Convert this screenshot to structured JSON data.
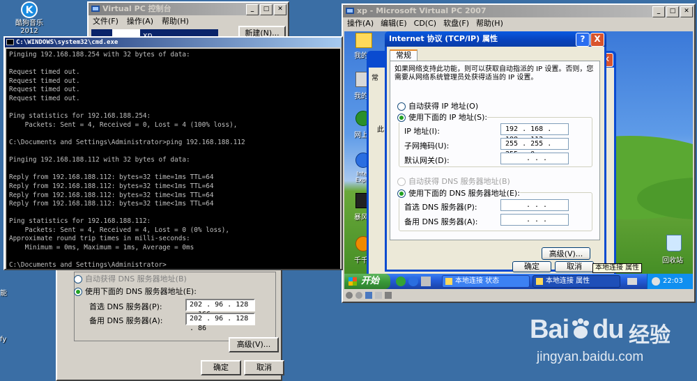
{
  "desktop": {
    "kugou_label": "酷狗音乐\n2012",
    "left_fragment_1": "能",
    "left_fragment_2": "fy"
  },
  "vpc_console": {
    "title": "Virtual PC 控制台",
    "menu": [
      "文件(F)",
      "操作(A)",
      "帮助(H)"
    ],
    "new_button": "新建(N)...",
    "vm_fragment": "xp"
  },
  "cmd": {
    "title": "C:\\WINDOWS\\system32\\cmd.exe",
    "lines": [
      "Pinging 192.168.188.254 with 32 bytes of data:",
      "",
      "Request timed out.",
      "Request timed out.",
      "Request timed out.",
      "Request timed out.",
      "",
      "Ping statistics for 192.168.188.254:",
      "    Packets: Sent = 4, Received = 0, Lost = 4 (100% loss),",
      "",
      "C:\\Documents and Settings\\Administrator>ping 192.168.188.112",
      "",
      "Pinging 192.168.188.112 with 32 bytes of data:",
      "",
      "Reply from 192.168.188.112: bytes=32 time=1ms TTL=64",
      "Reply from 192.168.188.112: bytes=32 time<1ms TTL=64",
      "Reply from 192.168.188.112: bytes=32 time<1ms TTL=64",
      "Reply from 192.168.188.112: bytes=32 time<1ms TTL=64",
      "",
      "Ping statistics for 192.168.188.112:",
      "    Packets: Sent = 4, Received = 4, Lost = 0 (0% loss),",
      "Approximate round trip times in milli-seconds:",
      "    Minimum = 0ms, Maximum = 1ms, Average = 0ms",
      "",
      "C:\\Documents and Settings\\Administrator>"
    ]
  },
  "host_dialog": {
    "auto_dns": "自动获得 DNS 服务器地址(B)",
    "use_dns": "使用下面的 DNS 服务器地址(E):",
    "preferred_label": "首选 DNS 服务器(P):",
    "preferred_value": "202 . 96 . 128 . 166",
    "alternate_label": "备用 DNS 服务器(A):",
    "alternate_value": "202 . 96 . 128 . 86",
    "advanced": "高级(V)...",
    "ok": "确定",
    "cancel": "取消"
  },
  "vpc_window": {
    "title": "xp - Microsoft Virtual PC 2007",
    "menu": [
      "操作(A)",
      "编辑(E)",
      "CD(C)",
      "软盘(F)",
      "帮助(H)"
    ]
  },
  "guest_desktop": {
    "icons": [
      "我的",
      "我的电",
      "网上",
      "Inter Explo",
      "暴风",
      "千千"
    ],
    "recycle_bin": "回收站"
  },
  "behind_dialog": {
    "tab": "常",
    "frag": "此"
  },
  "tcpip": {
    "title": "Internet 协议 (TCP/IP) 属性",
    "help_btn": "?",
    "close_btn": "X",
    "tab": "常规",
    "description": "如果网络支持此功能，则可以获取自动指派的 IP 设置。否则，您需要从网络系统管理员处获得适当的 IP 设置。",
    "auto_ip": "自动获得 IP 地址(O)",
    "use_ip": "使用下面的 IP 地址(S):",
    "ip_label": "IP 地址(I):",
    "ip_value": "192 . 168 . 188 . 112",
    "mask_label": "子网掩码(U):",
    "mask_value": "255 . 255 . 255 . 0",
    "gateway_label": "默认网关(D):",
    "gateway_value": ". . .",
    "auto_dns": "自动获得 DNS 服务器地址(B)",
    "use_dns": "使用下面的 DNS 服务器地址(E):",
    "pref_dns_label": "首选 DNS 服务器(P):",
    "pref_dns_value": ". . .",
    "alt_dns_label": "备用 DNS 服务器(A):",
    "alt_dns_value": ". . .",
    "advanced": "高级(V)...",
    "ok": "确定",
    "cancel": "取消"
  },
  "taskbar": {
    "start": "开始",
    "tasks": [
      "本地连接 状态",
      "本地连接 属性"
    ],
    "tooltip": "本地连接 属性",
    "clock": "22:03"
  },
  "watermark": {
    "brand_bai": "Bai",
    "brand_du": "du",
    "brand_cn": "经验",
    "url": "jingyan.baidu.com"
  }
}
